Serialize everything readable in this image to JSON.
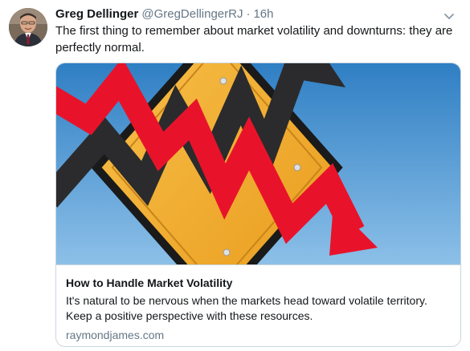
{
  "tweet": {
    "author_name": "Greg Dellinger",
    "author_handle": "@GregDellingerRJ",
    "separator": "·",
    "time": "16h",
    "text": "The first thing to remember about market volatility and downturns: they are perfectly normal."
  },
  "card": {
    "title": "How to Handle Market Volatility",
    "description": "It's natural to be nervous when the markets head toward volatile territory. Keep a positive perspective with these resources.",
    "domain": "raymondjames.com",
    "image_description_icon": "volatile-arrows-warning-sign-image"
  },
  "icons": {
    "caret": "chevron-down-icon"
  },
  "colors": {
    "text_primary": "#14171a",
    "text_secondary": "#657786",
    "border": "#ccd6dd",
    "sign_yellow": "#f5b22e",
    "arrow_red": "#e8132a",
    "arrow_dark": "#2b2b2d",
    "sky_blue": "#4a90c8"
  }
}
